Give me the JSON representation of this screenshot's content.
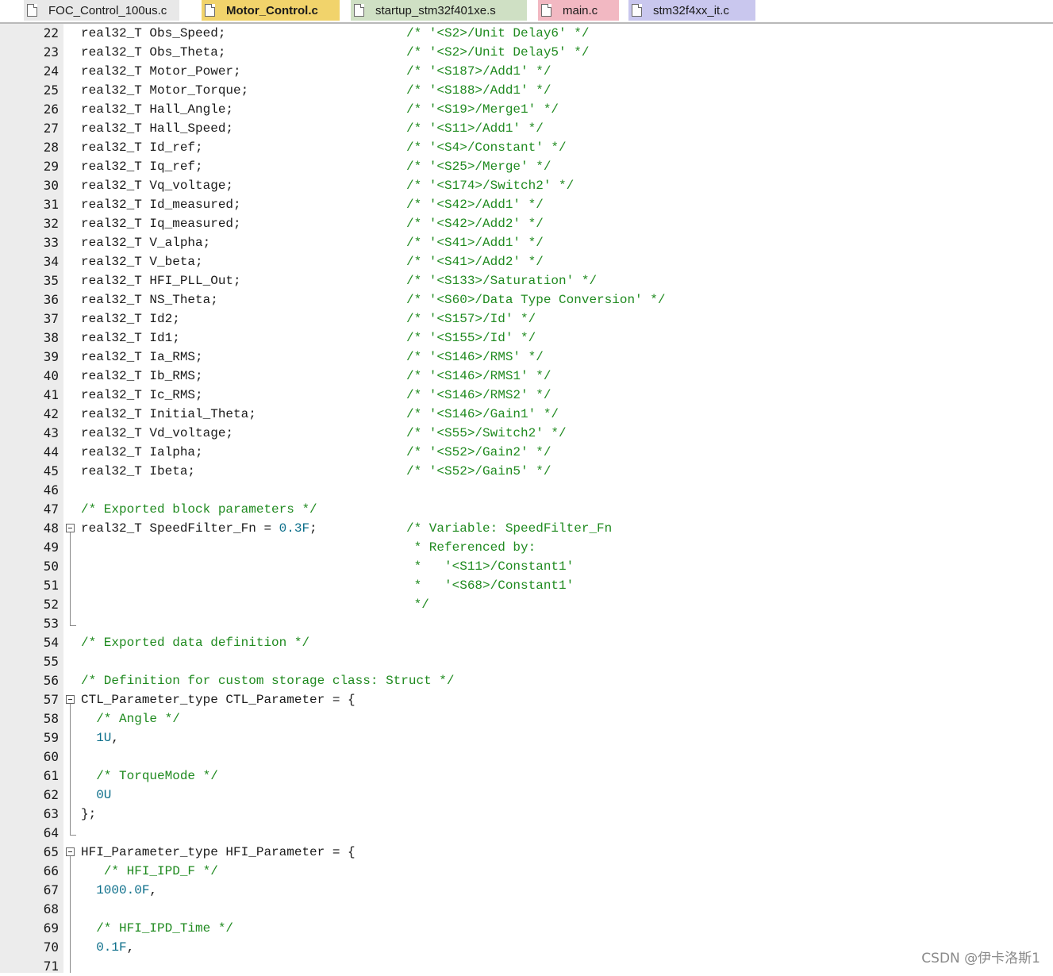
{
  "tabs": [
    {
      "label": "FOC_Control_100us.c",
      "active": false,
      "color": "#e8e8e8"
    },
    {
      "label": "Motor_Control.c",
      "active": true,
      "color": "#f1d36b"
    },
    {
      "label": "startup_stm32f401xe.s",
      "active": false,
      "color": "#cfe0c4"
    },
    {
      "label": "main.c",
      "active": false,
      "color": "#f2b8c2"
    },
    {
      "label": "stm32f4xx_it.c",
      "active": false,
      "color": "#c9c7ee"
    }
  ],
  "lines": [
    {
      "n": "22",
      "code": "real32_T Obs_Speed;",
      "comment": "/* '<S2>/Unit Delay6' */"
    },
    {
      "n": "23",
      "code": "real32_T Obs_Theta;",
      "comment": "/* '<S2>/Unit Delay5' */"
    },
    {
      "n": "24",
      "code": "real32_T Motor_Power;",
      "comment": "/* '<S187>/Add1' */"
    },
    {
      "n": "25",
      "code": "real32_T Motor_Torque;",
      "comment": "/* '<S188>/Add1' */"
    },
    {
      "n": "26",
      "code": "real32_T Hall_Angle;",
      "comment": "/* '<S19>/Merge1' */"
    },
    {
      "n": "27",
      "code": "real32_T Hall_Speed;",
      "comment": "/* '<S11>/Add1' */"
    },
    {
      "n": "28",
      "code": "real32_T Id_ref;",
      "comment": "/* '<S4>/Constant' */"
    },
    {
      "n": "29",
      "code": "real32_T Iq_ref;",
      "comment": "/* '<S25>/Merge' */"
    },
    {
      "n": "30",
      "code": "real32_T Vq_voltage;",
      "comment": "/* '<S174>/Switch2' */"
    },
    {
      "n": "31",
      "code": "real32_T Id_measured;",
      "comment": "/* '<S42>/Add1' */"
    },
    {
      "n": "32",
      "code": "real32_T Iq_measured;",
      "comment": "/* '<S42>/Add2' */"
    },
    {
      "n": "33",
      "code": "real32_T V_alpha;",
      "comment": "/* '<S41>/Add1' */"
    },
    {
      "n": "34",
      "code": "real32_T V_beta;",
      "comment": "/* '<S41>/Add2' */"
    },
    {
      "n": "35",
      "code": "real32_T HFI_PLL_Out;",
      "comment": "/* '<S133>/Saturation' */"
    },
    {
      "n": "36",
      "code": "real32_T NS_Theta;",
      "comment": "/* '<S60>/Data Type Conversion' */"
    },
    {
      "n": "37",
      "code": "real32_T Id2;",
      "comment": "/* '<S157>/Id' */"
    },
    {
      "n": "38",
      "code": "real32_T Id1;",
      "comment": "/* '<S155>/Id' */"
    },
    {
      "n": "39",
      "code": "real32_T Ia_RMS;",
      "comment": "/* '<S146>/RMS' */"
    },
    {
      "n": "40",
      "code": "real32_T Ib_RMS;",
      "comment": "/* '<S146>/RMS1' */"
    },
    {
      "n": "41",
      "code": "real32_T Ic_RMS;",
      "comment": "/* '<S146>/RMS2' */"
    },
    {
      "n": "42",
      "code": "real32_T Initial_Theta;",
      "comment": "/* '<S146>/Gain1' */"
    },
    {
      "n": "43",
      "code": "real32_T Vd_voltage;",
      "comment": "/* '<S55>/Switch2' */"
    },
    {
      "n": "44",
      "code": "real32_T Ialpha;",
      "comment": "/* '<S52>/Gain2' */"
    },
    {
      "n": "45",
      "code": "real32_T Ibeta;",
      "comment": "/* '<S52>/Gain5' */"
    },
    {
      "n": "46",
      "code": "",
      "comment": ""
    },
    {
      "n": "47",
      "code": "",
      "ccode": "/* Exported block parameters */",
      "comment": ""
    },
    {
      "n": "48",
      "code": "real32_T SpeedFilter_Fn = ",
      "num": "0.3F",
      "tail": ";",
      "comment": "/* Variable: SpeedFilter_Fn"
    },
    {
      "n": "49",
      "code": "",
      "comment": " * Referenced by:"
    },
    {
      "n": "50",
      "code": "",
      "comment": " *   '<S11>/Constant1'"
    },
    {
      "n": "51",
      "code": "",
      "comment": " *   '<S68>/Constant1'"
    },
    {
      "n": "52",
      "code": "",
      "comment": " */"
    },
    {
      "n": "53",
      "code": "",
      "comment": ""
    },
    {
      "n": "54",
      "code": "",
      "ccode": "/* Exported data definition */",
      "comment": ""
    },
    {
      "n": "55",
      "code": "",
      "comment": ""
    },
    {
      "n": "56",
      "code": "",
      "ccode": "/* Definition for custom storage class: Struct */",
      "comment": ""
    },
    {
      "n": "57",
      "code": "CTL_Parameter_type CTL_Parameter = {",
      "comment": ""
    },
    {
      "n": "58",
      "code": "  ",
      "ccode": "/* Angle */",
      "comment": ""
    },
    {
      "n": "59",
      "code": "  ",
      "num": "1U",
      "tail": ",",
      "comment": ""
    },
    {
      "n": "60",
      "code": "",
      "comment": ""
    },
    {
      "n": "61",
      "code": "  ",
      "ccode": "/* TorqueMode */",
      "comment": ""
    },
    {
      "n": "62",
      "code": "  ",
      "num": "0U",
      "comment": ""
    },
    {
      "n": "63",
      "code": "};",
      "comment": ""
    },
    {
      "n": "64",
      "code": "",
      "comment": ""
    },
    {
      "n": "65",
      "code": "HFI_Parameter_type HFI_Parameter = {",
      "comment": ""
    },
    {
      "n": "66",
      "code": "   ",
      "ccode": "/* HFI_IPD_F */",
      "comment": ""
    },
    {
      "n": "67",
      "code": "  ",
      "num": "1000.0F",
      "tail": ",",
      "comment": ""
    },
    {
      "n": "68",
      "code": "",
      "comment": ""
    },
    {
      "n": "69",
      "code": "  ",
      "ccode": "/* HFI_IPD_Time */",
      "comment": ""
    },
    {
      "n": "70",
      "code": "  ",
      "num": "0.1F",
      "tail": ",",
      "comment": ""
    },
    {
      "n": "71",
      "code": "",
      "comment": ""
    }
  ],
  "watermark": "CSDN @伊卡洛斯1"
}
